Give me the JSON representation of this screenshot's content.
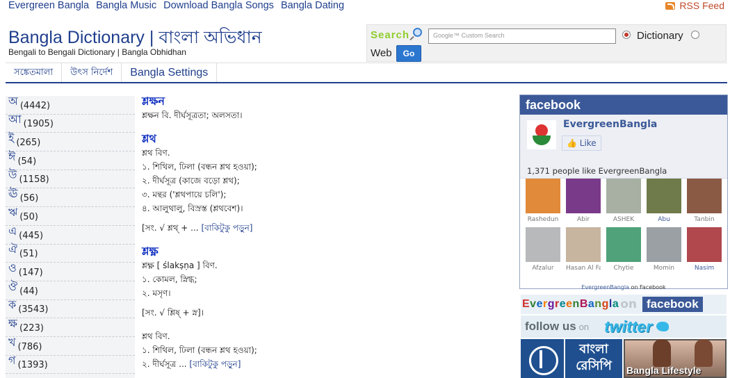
{
  "topnav": [
    {
      "label": "Evergreen Bangla"
    },
    {
      "label": "Bangla Music"
    },
    {
      "label": "Download Bangla Songs"
    },
    {
      "label": "Bangla Dating"
    }
  ],
  "rss": {
    "label": "RSS Feed"
  },
  "header": {
    "title": "Bangla Dictionary | বাংলা অভিধান",
    "subtitle": "Bengali to Bengali Dictionary | Bangla Obhidhan"
  },
  "search": {
    "label": "Search",
    "placeholder": "Google™ Custom Search",
    "option_dictionary": "Dictionary",
    "option_web": "Web",
    "go_label": "Go"
  },
  "menu": [
    {
      "label": "সঙ্কেতমালা"
    },
    {
      "label": "উৎস নির্দেশ"
    },
    {
      "label": "Bangla Settings"
    }
  ],
  "letters": [
    {
      "letter": "অ",
      "count": "(4442)"
    },
    {
      "letter": "আ",
      "count": "(1905)"
    },
    {
      "letter": "ই",
      "count": "(265)"
    },
    {
      "letter": "ঈ",
      "count": "(54)"
    },
    {
      "letter": "উ",
      "count": "(1158)"
    },
    {
      "letter": "ঊ",
      "count": "(56)"
    },
    {
      "letter": "ঋ",
      "count": "(50)"
    },
    {
      "letter": "এ",
      "count": "(445)"
    },
    {
      "letter": "ঐ",
      "count": "(51)"
    },
    {
      "letter": "ও",
      "count": "(147)"
    },
    {
      "letter": "ঔ",
      "count": "(44)"
    },
    {
      "letter": "ক",
      "count": "(3543)"
    },
    {
      "letter": "ক্ষ",
      "count": "(223)"
    },
    {
      "letter": "খ",
      "count": "(786)"
    },
    {
      "letter": "গ",
      "count": "(1393)"
    }
  ],
  "entries": [
    {
      "head": "শ্লক্ষন",
      "lines": [
        "শ্লক্ষন বি. দীর্ঘসূত্রতা; অলসতা।"
      ],
      "ref": "",
      "ref_link": ""
    },
    {
      "head": "শ্লথ",
      "lines": [
        "শ্লথ বিণ.",
        "১. শিথিল, ঢিলা (বন্ধন শ্লথ হওয়া);",
        "২. দীর্ঘসূত্র (কাজে বড়ো শ্লথ);",
        "৩. মন্থর ('শ্লথপায়ে চলি');",
        "৪. আলুথালু, বিস্রস্ত (শ্লথবেশ)।"
      ],
      "ref": "[সং. √ শ্লথ্ + ...",
      "ref_link": "[বাকিটুকু পড়ুন]"
    },
    {
      "head": "শ্লক্ষ্ণ",
      "lines": [
        "শ্লক্ষ্ণ [ ślakṣṇa ] বিণ.",
        "১. কোমল, স্নিগ্ধ;",
        "২. মসৃণ।"
      ],
      "ref": "[সং. √ শ্লিষ্ + স্ন]।",
      "ref_link": ""
    },
    {
      "head": "",
      "lines": [
        "শ্লথ বিণ.",
        "১. শিথিল, ঢিলা (বন্ধন শ্লথ হওয়া);"
      ],
      "ref": "",
      "ref_link": ""
    }
  ],
  "entry_tail": {
    "text": "২. দীর্ঘসূত্র ...",
    "link": "[বাকিটুকু পড়ুন]"
  },
  "facebook": {
    "header": "facebook",
    "page_name": "EvergreenBangla",
    "like_label": "Like",
    "count_text": "1,371 people like EvergreenBangla",
    "faces": [
      {
        "name": "Rashedun",
        "color": "#e08a3a",
        "blue": false
      },
      {
        "name": "Abir",
        "color": "#7a3a8a",
        "blue": false
      },
      {
        "name": "ASHEK",
        "color": "#a7b0a2",
        "blue": false
      },
      {
        "name": "Abu",
        "color": "#6f7b4a",
        "blue": true
      },
      {
        "name": "Tanbin",
        "color": "#8b5a44",
        "blue": false
      },
      {
        "name": "Afzalur",
        "color": "#b7b9bb",
        "blue": false
      },
      {
        "name": "Hasan Al Fa",
        "color": "#c7b5a0",
        "blue": false
      },
      {
        "name": "Chytie",
        "color": "#4fa27a",
        "blue": false
      },
      {
        "name": "Momin",
        "color": "#9aa0a4",
        "blue": false
      },
      {
        "name": "Nasim",
        "color": "#b0484e",
        "blue": true
      }
    ],
    "footer_link": "EvergreenBangla",
    "footer_text": " on Facebook"
  },
  "banners": {
    "eg_text": "EvergreenBangla",
    "on_text": "on",
    "fb_text": "facebook",
    "follow_text": "follow us",
    "follow_on": "on",
    "twitter_text": "twitter",
    "recipe_line1": "বাংলা",
    "recipe_line2": "রেসিপি",
    "lifestyle_text": "Bangla Lifestyle"
  }
}
